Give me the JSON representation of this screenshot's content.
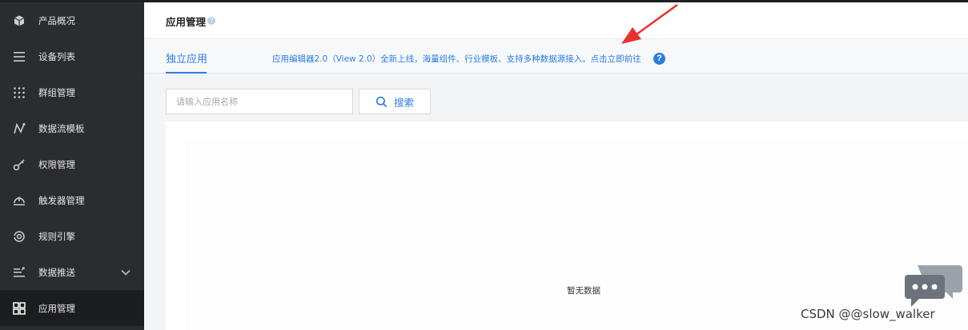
{
  "sidebar": {
    "items": [
      {
        "label": "产品概况",
        "icon": "cube-icon",
        "active": false
      },
      {
        "label": "设备列表",
        "icon": "list-icon",
        "active": false
      },
      {
        "label": "群组管理",
        "icon": "grid-dots-icon",
        "active": false
      },
      {
        "label": "数据流模板",
        "icon": "flow-icon",
        "active": false
      },
      {
        "label": "权限管理",
        "icon": "key-icon",
        "active": false
      },
      {
        "label": "触发器管理",
        "icon": "trigger-icon",
        "active": false
      },
      {
        "label": "规则引擎",
        "icon": "rule-engine-icon",
        "active": false
      },
      {
        "label": "数据推送",
        "icon": "push-icon",
        "active": false,
        "has_submenu": true
      },
      {
        "label": "应用管理",
        "icon": "apps-icon",
        "active": true
      }
    ]
  },
  "header": {
    "title": "应用管理",
    "help_icon": "question-icon"
  },
  "tabs": [
    {
      "label": "独立应用",
      "active": true
    }
  ],
  "notice": {
    "text": "应用编辑器2.0（View 2.0）全新上线，海量组件、行业模板、支持多种数据源接入。点击立即前往",
    "help_icon": "question-circle-icon"
  },
  "search": {
    "placeholder": "请输入应用名称",
    "value": "",
    "button_label": "搜索"
  },
  "content": {
    "empty_text": "暂无数据"
  },
  "watermark": {
    "text": "CSDN @@slow_walker"
  },
  "colors": {
    "sidebar_bg": "#2b2c2e",
    "accent": "#2a7ee0",
    "annotation_arrow": "#e8322c"
  }
}
